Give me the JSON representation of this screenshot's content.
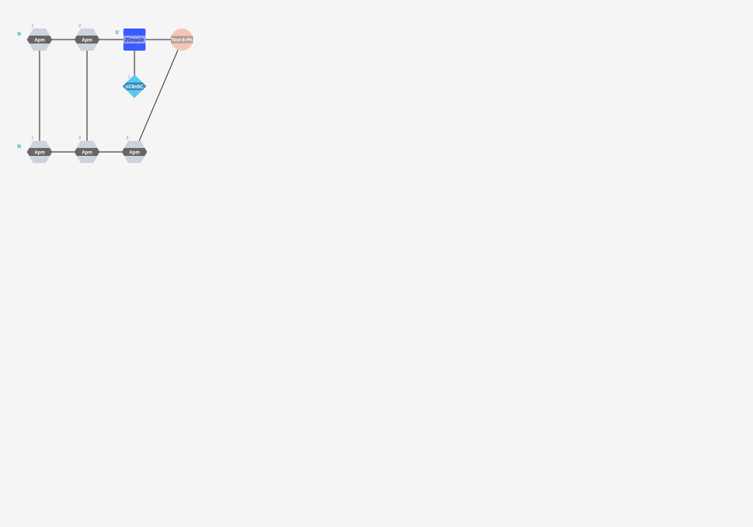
{
  "colors": {
    "background": "#f5f5f5",
    "hex_fill": "#cdd3dc",
    "hex_band": "#666666",
    "square_fill": "#3a5cff",
    "square_band": "#8fa2ff",
    "diamond_fill": "#5cc8f0",
    "diamond_band": "#3a8fbf",
    "circle_fill": "#f4c4b4",
    "circle_band": "#b89a90",
    "terminal": "#1aa3b8",
    "bond": "#888888",
    "link": "#333333"
  },
  "strands": [
    {
      "terminal": "N",
      "nodes": [
        {
          "shape": "hexagon",
          "label": "Apm",
          "position": "1"
        },
        {
          "shape": "hexagon",
          "label": "Apm",
          "position": "2"
        }
      ]
    },
    {
      "terminal": "N",
      "nodes": [
        {
          "shape": "hexagon",
          "label": "Apm",
          "position": "1"
        },
        {
          "shape": "hexagon",
          "label": "Apm",
          "position": "2"
        },
        {
          "shape": "hexagon",
          "label": "Apm",
          "position": "3"
        }
      ]
    }
  ],
  "nucleotide": {
    "terminal": "5'",
    "sugar": {
      "shape": "square",
      "label": "25moe3r"
    },
    "base": {
      "shape": "diamond",
      "label": "nC6n5C",
      "position": "1"
    },
    "linker": {
      "shape": "circle",
      "label": "Test-6-Ph"
    }
  }
}
